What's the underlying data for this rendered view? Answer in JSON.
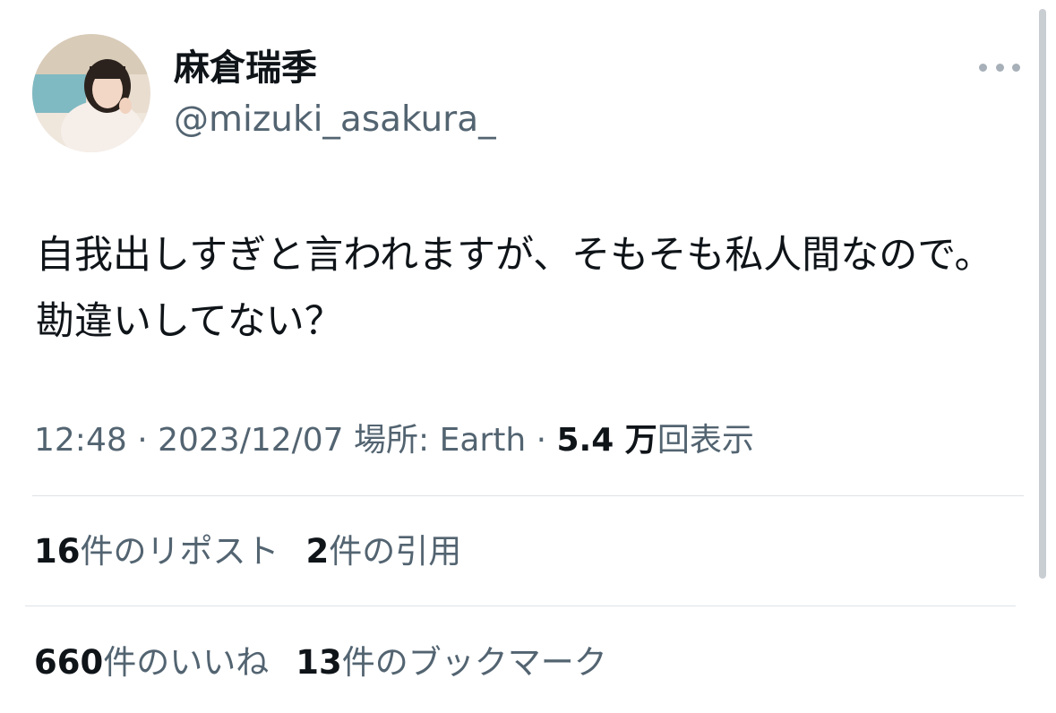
{
  "author": {
    "display_name": "麻倉瑞季",
    "handle": "@mizuki_asakura_"
  },
  "tweet": {
    "text": "自我出しすぎと言われますが、そもそも私人間なので。勘違いしてない？"
  },
  "meta": {
    "time": "12:48",
    "sep1": " · ",
    "date": "2023/12/07",
    "location": " 場所: Earth",
    "sep2": " · ",
    "views_count": "5.4 万",
    "views_label": "回表示"
  },
  "stats": {
    "reposts": {
      "count": "16",
      "label": "件のリポスト"
    },
    "quotes": {
      "count": "2",
      "label": "件の引用"
    },
    "likes": {
      "count": "660",
      "label": "件のいいね"
    },
    "bookmarks": {
      "count": "13",
      "label": "件のブックマーク"
    }
  },
  "colors": {
    "text_primary": "#0f1419",
    "text_secondary": "#536471",
    "divider": "#dfe3e7"
  },
  "icons": {
    "more": "more-horizontal-icon"
  }
}
